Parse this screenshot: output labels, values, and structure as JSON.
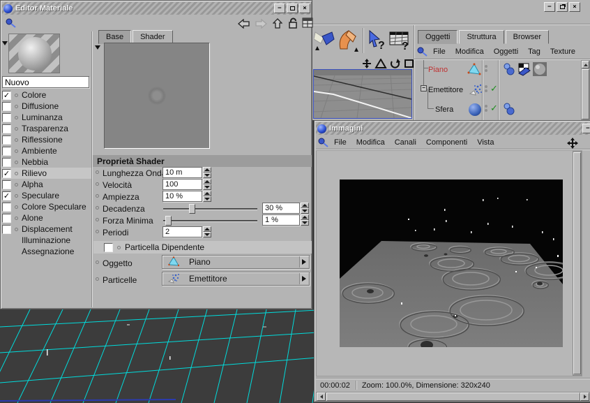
{
  "colors": {
    "accent_red": "#c03232",
    "grid_cyan": "#00dcdc",
    "check_green": "#1f8c1f",
    "ui_gray": "#b4b4b4"
  },
  "material_editor": {
    "title": "Editor Materiale",
    "tabs": [
      "Base",
      "Shader"
    ],
    "name_value": "Nuovo",
    "channels": [
      {
        "label": "Colore",
        "check": "✓"
      },
      {
        "label": "Diffusione",
        "check": ""
      },
      {
        "label": "Luminanza",
        "check": ""
      },
      {
        "label": "Trasparenza",
        "check": ""
      },
      {
        "label": "Riflessione",
        "check": ""
      },
      {
        "label": "Ambiente",
        "check": ""
      },
      {
        "label": "Nebbia",
        "check": ""
      },
      {
        "label": "Rilievo",
        "check": "✓"
      },
      {
        "label": "Alpha",
        "check": ""
      },
      {
        "label": "Speculare",
        "check": "✓"
      },
      {
        "label": "Colore Speculare",
        "check": ""
      },
      {
        "label": "Alone",
        "check": ""
      },
      {
        "label": "Displacement",
        "check": ""
      },
      {
        "label": "Illuminazione"
      },
      {
        "label": "Assegnazione"
      }
    ],
    "shader": {
      "header": "Proprietà Shader",
      "rows": [
        {
          "label": "Lunghezza Onda",
          "value": "10 m"
        },
        {
          "label": "Velocità",
          "value": "100"
        },
        {
          "label": "Ampiezza",
          "value": "10 %"
        },
        {
          "label": "Decadenza",
          "value": "30 %"
        },
        {
          "label": "Forza Minima",
          "value": "1 %"
        },
        {
          "label": "Periodi",
          "value": "2"
        }
      ],
      "particle_dependent": "Particella Dipendente",
      "object_label": "Oggetto",
      "object_value": "Piano",
      "particles_label": "Particelle",
      "particles_value": "Emettitore"
    }
  },
  "main_window": {
    "tabs": [
      "Oggetti",
      "Struttura",
      "Browser"
    ],
    "menu": [
      "File",
      "Modifica",
      "Oggetti",
      "Tag",
      "Texture"
    ],
    "objects": [
      {
        "name": "Piano",
        "selected": true
      },
      {
        "name": "Emettitore",
        "enabled": true
      },
      {
        "name": "Sfera",
        "enabled": true
      }
    ]
  },
  "images_window": {
    "title": "Immagini",
    "menu": [
      "File",
      "Modifica",
      "Canali",
      "Componenti",
      "Vista"
    ],
    "status_time": "00:00:02",
    "status_info": "Zoom: 100.0%, Dimensione: 320x240"
  }
}
